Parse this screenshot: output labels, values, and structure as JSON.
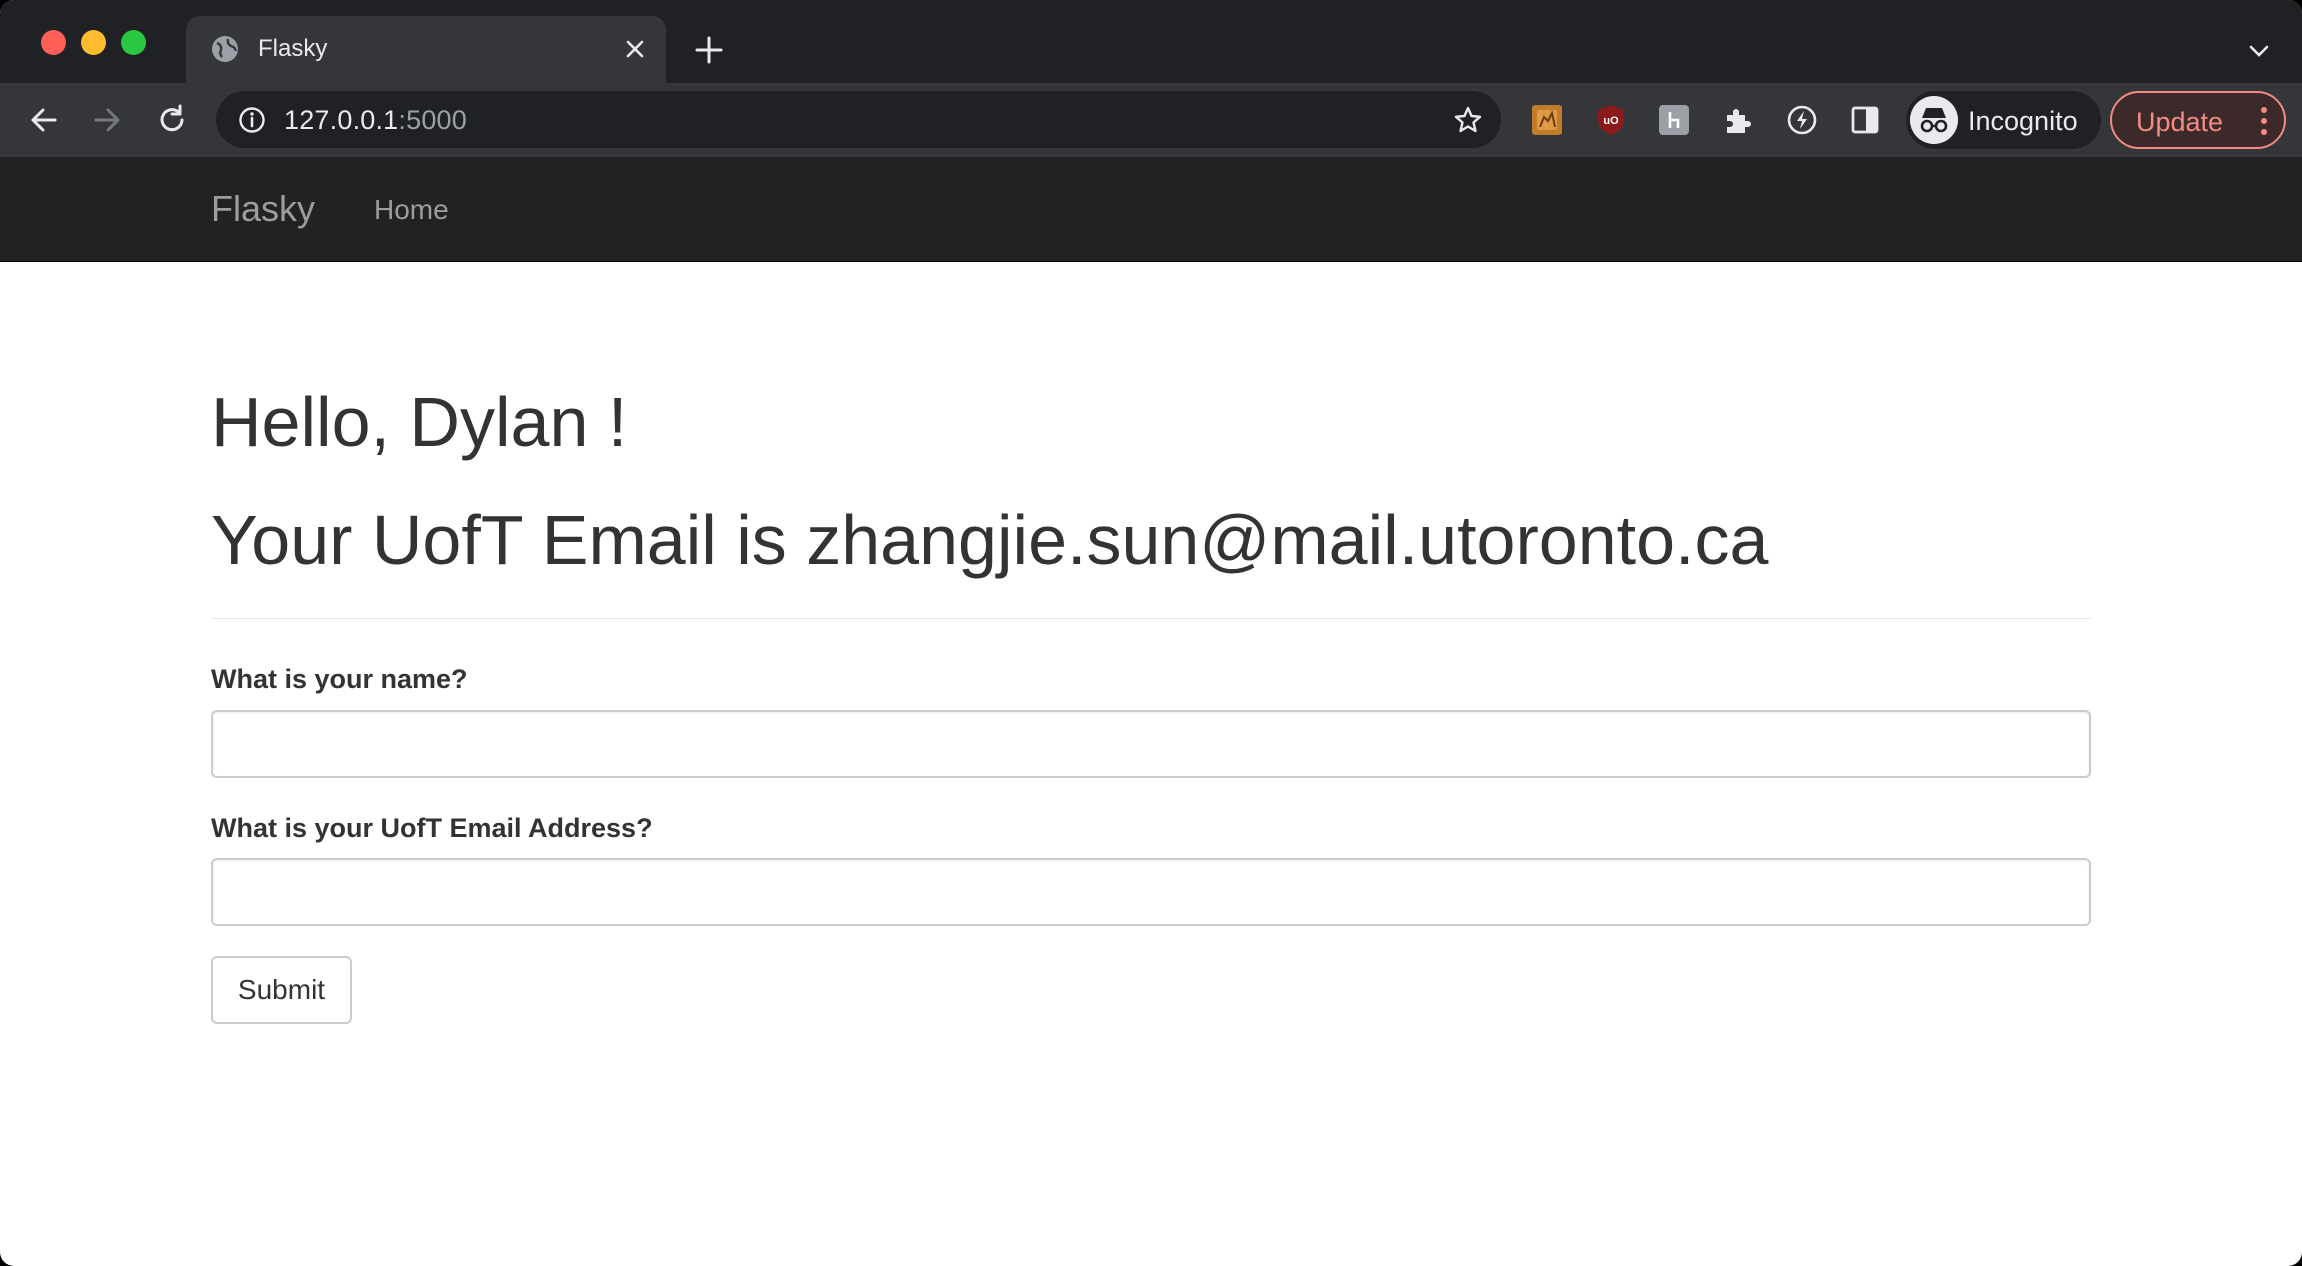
{
  "browser": {
    "tab_title": "Flasky",
    "url_host": "127.0.0.1",
    "url_port": ":5000",
    "profile_label": "Incognito",
    "update_label": "Update",
    "icons": [
      "back-icon",
      "forward-icon",
      "reload-icon",
      "info-icon",
      "star-icon",
      "extension-icon",
      "ublock-icon",
      "puzzle-icon",
      "sidepanel-icon",
      "incognito-icon",
      "more-icon"
    ]
  },
  "navbar": {
    "brand": "Flasky",
    "home_label": "Home"
  },
  "main": {
    "greeting": "Hello, Dylan !",
    "email_line": "Your UofT Email is zhangjie.sun@mail.utoronto.ca",
    "form": {
      "name_label": "What is your name?",
      "name_value": "",
      "email_label": "What is your UofT Email Address?",
      "email_value": "",
      "submit_label": "Submit"
    }
  },
  "colors": {
    "navbar_bg": "#222222",
    "text": "#333333",
    "update_accent": "#f28b82"
  }
}
